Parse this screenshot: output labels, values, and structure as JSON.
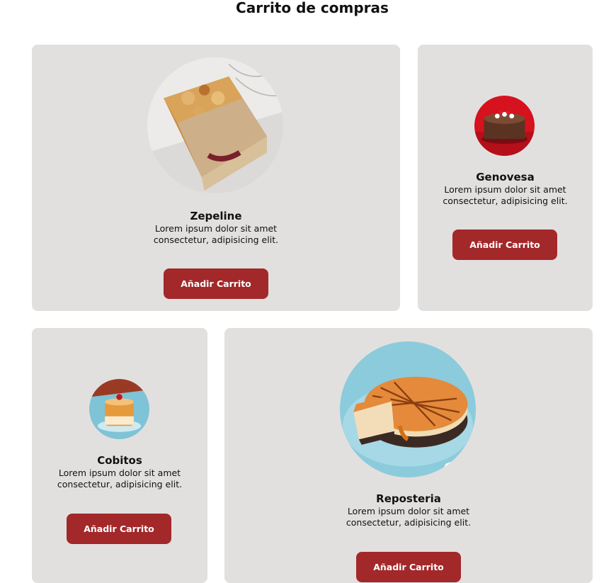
{
  "page": {
    "title": "Carrito de compras"
  },
  "colors": {
    "card_bg": "#e2e0df",
    "button_bg": "#a3282a",
    "button_text": "#ffffff"
  },
  "products": [
    {
      "name": "Zepeline",
      "image": "loaf-cake-image",
      "desc_line1": "Lorem ipsum dolor sit amet",
      "desc_line2": "consectetur, adipisicing elit.",
      "button_label": "Añadir Carrito"
    },
    {
      "name": "Genovesa",
      "image": "chocolate-cake-image",
      "desc_line1": "Lorem ipsum dolor sit amet",
      "desc_line2": "consectetur, adipisicing elit.",
      "button_label": "Añadir Carrito"
    },
    {
      "name": "Cobitos",
      "image": "caramel-cup-dessert-image",
      "desc_line1": "Lorem ipsum dolor sit amet",
      "desc_line2": "consectetur, adipisicing elit.",
      "button_label": "Añadir Carrito"
    },
    {
      "name": "Reposteria",
      "image": "caramel-cheesecake-image",
      "desc_line1": "Lorem ipsum dolor sit amet",
      "desc_line2": "consectetur, adipisicing elit.",
      "button_label": "Añadir Carrito"
    }
  ]
}
